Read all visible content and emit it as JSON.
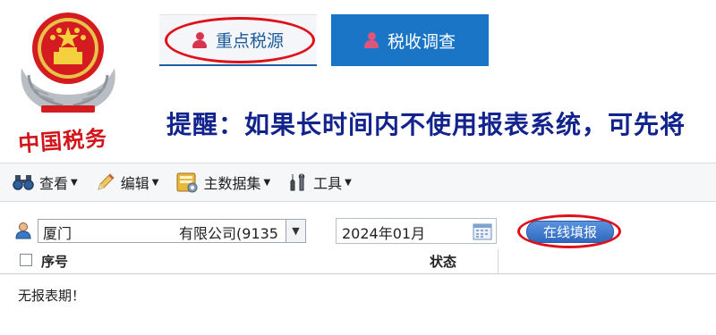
{
  "header": {
    "logo_text": "中国税务",
    "tabs": [
      {
        "label": "重点税源",
        "active": true
      },
      {
        "label": "税收调查",
        "active": false
      }
    ],
    "notice": "提醒：如果长时间内不使用报表系统，可先将"
  },
  "toolbar": {
    "items": [
      {
        "label": "查看",
        "icon": "binoculars-icon"
      },
      {
        "label": "编辑",
        "icon": "pencil-icon"
      },
      {
        "label": "主数据集",
        "icon": "dataset-icon"
      },
      {
        "label": "工具",
        "icon": "tools-icon"
      }
    ]
  },
  "filter": {
    "company_prefix": "厦门",
    "company_suffix": "有限公司(9135",
    "period": "2024年01月",
    "fill_button": "在线填报"
  },
  "table": {
    "columns": [
      "序号",
      "状态"
    ],
    "empty_message": "无报表期！"
  },
  "colors": {
    "tab_active_text": "#1b5a98",
    "tab_inactive_bg": "#1a75c6",
    "notice_text": "#12238d",
    "annotation_circle": "#e01018",
    "logo_red": "#d0161b"
  }
}
